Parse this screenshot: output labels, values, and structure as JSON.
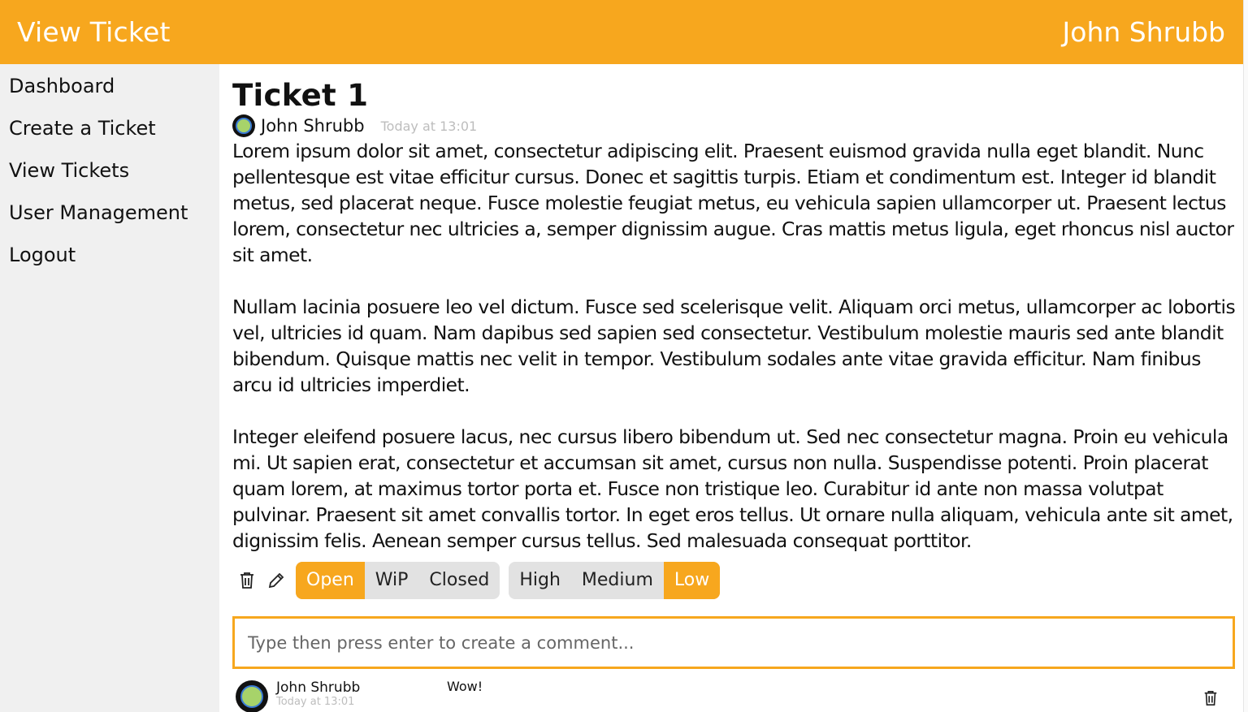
{
  "header": {
    "title": "View Ticket",
    "user": "John Shrubb"
  },
  "sidebar": {
    "items": [
      {
        "label": "Dashboard"
      },
      {
        "label": "Create a Ticket"
      },
      {
        "label": "View Tickets"
      },
      {
        "label": "User Management"
      },
      {
        "label": "Logout"
      }
    ]
  },
  "ticket": {
    "title": "Ticket 1",
    "author": "John Shrubb",
    "time": "Today at 13:01",
    "paragraphs": [
      "Lorem ipsum dolor sit amet, consectetur adipiscing elit. Praesent euismod gravida nulla eget blandit. Nunc pellentesque est vitae efficitur cursus. Donec et sagittis turpis. Etiam et condimentum est. Integer id blandit metus, sed placerat neque. Fusce molestie feugiat metus, eu vehicula sapien ullamcorper ut. Praesent lectus lorem, consectetur nec ultricies a, semper dignissim augue. Cras mattis metus ligula, eget rhoncus nisl auctor sit amet.",
      "Nullam lacinia posuere leo vel dictum. Fusce sed scelerisque velit. Aliquam orci metus, ullamcorper ac lobortis vel, ultricies id quam. Nam dapibus sed sapien sed consectetur. Vestibulum molestie mauris sed ante blandit bibendum. Quisque mattis nec velit in tempor. Vestibulum sodales ante vitae gravida efficitur. Nam finibus arcu id ultricies imperdiet.",
      "Integer eleifend posuere lacus, nec cursus libero bibendum ut. Sed nec consectetur magna. Proin eu vehicula mi. Ut sapien erat, consectetur et accumsan sit amet, cursus non nulla. Suspendisse potenti. Proin placerat quam lorem, at maximus tortor porta et. Fusce non tristique leo. Curabitur id ante non massa volutpat pulvinar. Praesent sit amet convallis tortor. In eget eros tellus. Ut ornare nulla aliquam, vehicula ante sit amet, dignissim felis. Aenean semper cursus tellus. Sed malesuada consequat porttitor."
    ]
  },
  "status": {
    "options": [
      "Open",
      "WiP",
      "Closed"
    ],
    "selected": "Open"
  },
  "priority": {
    "options": [
      "High",
      "Medium",
      "Low"
    ],
    "selected": "Low"
  },
  "icons": {
    "delete": "trash-icon",
    "edit": "pencil-icon"
  },
  "comment_input": {
    "placeholder": "Type then press enter to create a comment...",
    "value": ""
  },
  "comments": [
    {
      "author": "John Shrubb",
      "time": "Today at 13:01",
      "text": "Wow!"
    }
  ],
  "colors": {
    "accent": "#f7a71e",
    "sidebar_bg": "#f0f0f0",
    "segment_bg": "#e2e2e2"
  }
}
